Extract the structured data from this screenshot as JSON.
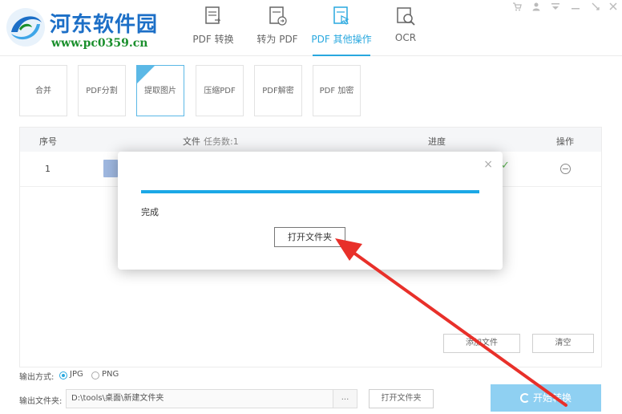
{
  "watermark": {
    "title": "河东软件园",
    "url": "www.pc0359.cn"
  },
  "main_tabs": [
    {
      "label": "PDF 转换",
      "icon": "pdf-convert-icon"
    },
    {
      "label": "转为 PDF",
      "icon": "to-pdf-icon"
    },
    {
      "label": "PDF 其他操作",
      "icon": "pdf-other-icon"
    },
    {
      "label": "OCR",
      "icon": "ocr-icon"
    }
  ],
  "active_tab": "PDF 其他操作",
  "window_controls": [
    "cart-icon",
    "user-icon",
    "menu-icon",
    "minimize-icon",
    "close-icon"
  ],
  "tools": [
    {
      "label": "合并"
    },
    {
      "label": "PDF分割"
    },
    {
      "label": "提取图片"
    },
    {
      "label": "压缩PDF"
    },
    {
      "label": "PDF解密"
    },
    {
      "label": "PDF 加密"
    }
  ],
  "active_tool": "提取图片",
  "table": {
    "headers": {
      "index": "序号",
      "file": "文件",
      "task_count": "任务数:1",
      "progress": "进度",
      "action": "操作"
    },
    "rows": [
      {
        "index": "1"
      }
    ]
  },
  "buttons": {
    "add_file": "添加文件",
    "clear": "清空",
    "open_folder": "打开文件夹",
    "start": "开始转换",
    "browse": "..."
  },
  "output": {
    "mode_label": "输出方式:",
    "options": [
      "JPG",
      "PNG"
    ],
    "selected": "JPG",
    "folder_label": "输出文件夹:",
    "folder_path": "D:\\tools\\桌面\\新建文件夹"
  },
  "modal": {
    "progress_percent": 100,
    "status": "完成",
    "button": "打开文件夹",
    "close": "×"
  },
  "colors": {
    "accent": "#29a8df",
    "progress": "#1ba8e6",
    "arrow": "#e8302a",
    "logo_blue": "#1c6fc7",
    "logo_green": "#1a8f2c"
  }
}
